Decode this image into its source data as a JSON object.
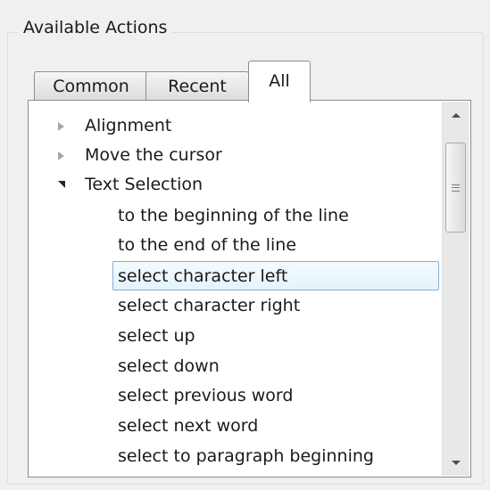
{
  "group": {
    "title": "Available Actions"
  },
  "tabs": [
    {
      "label": "Common",
      "active": false
    },
    {
      "label": "Recent",
      "active": false
    },
    {
      "label": "All",
      "active": true
    }
  ],
  "tree": {
    "categories": [
      {
        "label": "Alignment",
        "expanded": false
      },
      {
        "label": "Move the cursor",
        "expanded": false
      },
      {
        "label": "Text Selection",
        "expanded": true
      }
    ],
    "text_selection_items": [
      "to the beginning of the line",
      "to the end of the line",
      "select character left",
      "select character right",
      "select up",
      "select down",
      "select previous word",
      "select next word",
      "select to paragraph beginning"
    ],
    "selected_item": "select character left"
  },
  "scrollbar": {
    "up_icon": "arrow-up-icon",
    "down_icon": "arrow-down-icon",
    "grip_icon": "grip-icon"
  },
  "colors": {
    "selection_border": "#84acdd",
    "selection_fill": "#e4f3fc"
  }
}
